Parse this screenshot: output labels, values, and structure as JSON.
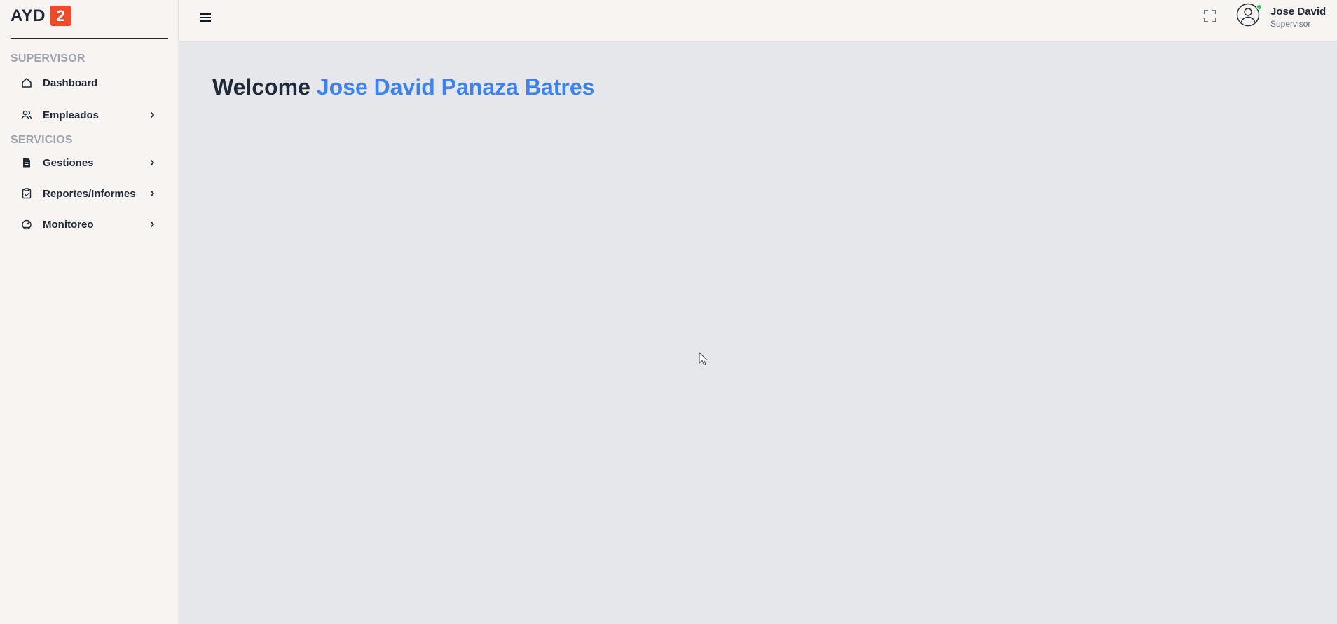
{
  "brand": {
    "text": "AYD",
    "badge": "2",
    "badge_color": "#ef4a2a"
  },
  "sidebar": {
    "sections": [
      {
        "title": "SUPERVISOR"
      },
      {
        "title": "SERVICIOS"
      }
    ],
    "items": [
      {
        "label": "Dashboard",
        "icon": "home-icon",
        "has_submenu": false
      },
      {
        "label": "Empleados",
        "icon": "users-icon",
        "has_submenu": true
      },
      {
        "label": "Gestiones",
        "icon": "file-icon",
        "has_submenu": true
      },
      {
        "label": "Reportes/Informes",
        "icon": "clipboard-check-icon",
        "has_submenu": true
      },
      {
        "label": "Monitoreo",
        "icon": "gauge-icon",
        "has_submenu": true
      }
    ]
  },
  "header": {
    "user": {
      "name": "Jose David",
      "role": "Supervisor",
      "status": "online",
      "status_color": "#34c759"
    }
  },
  "main": {
    "welcome_prefix": "Welcome",
    "welcome_name": "Jose David Panaza Batres",
    "accent_color": "#3b82f6"
  }
}
